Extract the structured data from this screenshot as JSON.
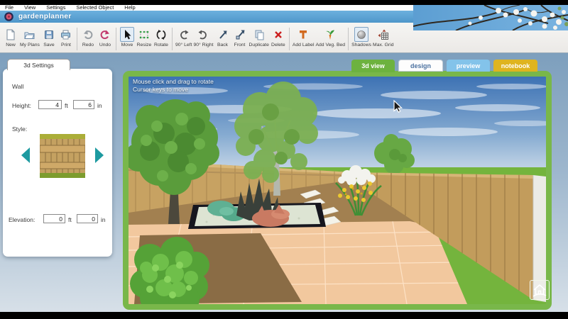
{
  "menu_bar": {
    "items": [
      "File",
      "View",
      "Settings",
      "Selected Object",
      "Help"
    ]
  },
  "title_bar": {
    "app_name": "gardenplanner"
  },
  "toolbar": {
    "items": [
      {
        "name": "new",
        "label": "New"
      },
      {
        "name": "my-plans",
        "label": "My Plans"
      },
      {
        "name": "save",
        "label": "Save"
      },
      {
        "name": "print",
        "label": "Print"
      },
      {
        "name": "redo",
        "label": "Redo",
        "disabled": true
      },
      {
        "name": "undo",
        "label": "Undo"
      },
      {
        "name": "move",
        "label": "Move",
        "selected": true
      },
      {
        "name": "resize",
        "label": "Resize"
      },
      {
        "name": "rotate",
        "label": "Rotate"
      },
      {
        "name": "rotate-90-left",
        "label": "90° Left"
      },
      {
        "name": "rotate-90-right",
        "label": "90° Right"
      },
      {
        "name": "back",
        "label": "Back"
      },
      {
        "name": "front",
        "label": "Front"
      },
      {
        "name": "duplicate",
        "label": "Duplicate"
      },
      {
        "name": "delete",
        "label": "Delete"
      },
      {
        "name": "add-label",
        "label": "Add Label"
      },
      {
        "name": "add-veg-bed",
        "label": "Add Veg. Bed"
      },
      {
        "name": "shadows",
        "label": "Shadows",
        "selected": true
      },
      {
        "name": "max-grid",
        "label": "Max. Grid"
      }
    ]
  },
  "settings_panel": {
    "title": "3d Settings",
    "section_label": "Wall",
    "height_label": "Height:",
    "height_ft": "4",
    "height_in": "6",
    "unit_ft": "ft",
    "unit_in": "in",
    "style_label": "Style:",
    "elevation_label": "Elevation:",
    "elevation_ft": "0",
    "elevation_in": "0"
  },
  "view_tabs": {
    "tabs": [
      {
        "name": "3d-view",
        "label": "3d view",
        "active": true
      },
      {
        "name": "design",
        "label": "design",
        "active": false
      },
      {
        "name": "preview",
        "label": "preview",
        "active": false
      },
      {
        "name": "notebook",
        "label": "notebook",
        "active": false
      }
    ]
  },
  "viewport": {
    "hint_line1": "Mouse click and drag to rotate",
    "hint_line2": "Cursor keys to move"
  },
  "colors": {
    "title_bar_blue": "#58a0d0",
    "panel_border_green": "#79b74a",
    "active_tab_green": "#6db23f",
    "tab_preview_blue": "#83c3ea",
    "tab_notebook_gold": "#dfb41f",
    "lawn_green": "#74b43d",
    "fence_tan": "#c7a262",
    "paving_peach": "#f2c89e",
    "sky_blue": "#3d72b4"
  }
}
